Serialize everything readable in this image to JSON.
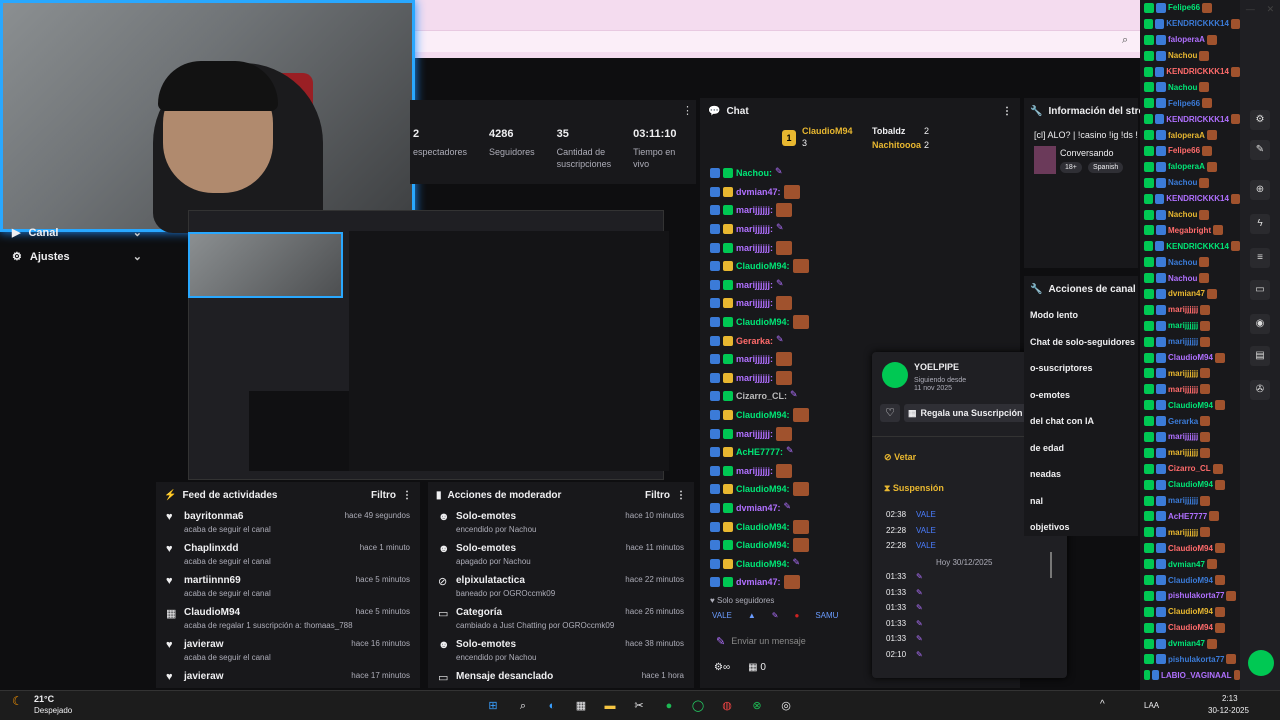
{
  "sidebar": {
    "items": [
      {
        "label": "Canal"
      },
      {
        "label": "Ajustes"
      }
    ]
  },
  "stats": [
    {
      "value": "2",
      "label": "espectadores"
    },
    {
      "value": "4286",
      "label": "Seguidores"
    },
    {
      "value": "35",
      "label": "Cantidad de suscripciones"
    },
    {
      "value": "03:11:10",
      "label": "Tiempo en vivo"
    }
  ],
  "feed": {
    "title": "Feed de actividades",
    "filter": "Filtro",
    "items": [
      {
        "name": "bayritonma6",
        "sub": "acaba de seguir el canal",
        "time": "hace 49 segundos"
      },
      {
        "name": "Chaplinxdd",
        "sub": "acaba de seguir el canal",
        "time": "hace 1 minuto"
      },
      {
        "name": "martiinnn69",
        "sub": "acaba de seguir el canal",
        "time": "hace 5 minutos"
      },
      {
        "name": "ClaudioM94",
        "sub": "acaba de regalar 1 suscripción a: thomaas_788",
        "time": "hace 5 minutos"
      },
      {
        "name": "javieraw",
        "sub": "acaba de seguir el canal",
        "time": "hace 16 minutos"
      },
      {
        "name": "javieraw",
        "sub": "",
        "time": "hace 17 minutos"
      }
    ]
  },
  "mod": {
    "title": "Acciones de moderador",
    "filter": "Filtro",
    "items": [
      {
        "name": "Solo-emotes",
        "sub": "encendido por Nachou",
        "time": "hace 10 minutos"
      },
      {
        "name": "Solo-emotes",
        "sub": "apagado por Nachou",
        "time": "hace 11 minutos"
      },
      {
        "name": "elpixulatactica",
        "sub": "baneado por OGROccmk09",
        "time": "hace 22 minutos"
      },
      {
        "name": "Categoría",
        "sub": "cambiado a Just Chatting por OGROccmk09",
        "time": "hace 26 minutos"
      },
      {
        "name": "Solo-emotes",
        "sub": "encendido por Nachou",
        "time": "hace 38 minutos"
      },
      {
        "name": "Mensaje desanclado",
        "sub": "",
        "time": "hace 1 hora"
      }
    ]
  },
  "chat": {
    "title": "Chat",
    "top": [
      {
        "name": "ClaudioM94",
        "count": "3"
      },
      {
        "name": "Tobaldz",
        "count": "2"
      },
      {
        "name": "Nachitoooa",
        "count": "2"
      }
    ],
    "messages": [
      {
        "user": "Nachou:",
        "color": "#00e676"
      },
      {
        "user": "dvmian47:",
        "color": "#b070ff"
      },
      {
        "user": "marijjjjjj:",
        "color": "#b070ff"
      },
      {
        "user": "marijjjjjj:",
        "color": "#b070ff"
      },
      {
        "user": "marijjjjjj:",
        "color": "#b070ff"
      },
      {
        "user": "ClaudioM94:",
        "color": "#00e676"
      },
      {
        "user": "marijjjjjj:",
        "color": "#b070ff"
      },
      {
        "user": "marijjjjjj:",
        "color": "#b070ff"
      },
      {
        "user": "ClaudioM94:",
        "color": "#00e676"
      },
      {
        "user": "Gerarka:",
        "color": "#ff6b6b"
      },
      {
        "user": "marijjjjjj:",
        "color": "#b070ff"
      },
      {
        "user": "marijjjjjj:",
        "color": "#b070ff"
      },
      {
        "user": "Cizarro_CL:",
        "color": "#bbbbbb"
      },
      {
        "user": "ClaudioM94:",
        "color": "#00e676"
      },
      {
        "user": "marijjjjjj:",
        "color": "#b070ff"
      },
      {
        "user": "AcHE7777:",
        "color": "#00e676"
      },
      {
        "user": "marijjjjjj:",
        "color": "#b070ff"
      },
      {
        "user": "ClaudioM94:",
        "color": "#00e676"
      },
      {
        "user": "dvmian47:",
        "color": "#b070ff"
      },
      {
        "user": "ClaudioM94:",
        "color": "#00e676"
      },
      {
        "user": "ClaudioM94:",
        "color": "#00e676"
      },
      {
        "user": "ClaudioM94:",
        "color": "#00e676"
      },
      {
        "user": "dvmian47:",
        "color": "#b070ff"
      }
    ],
    "followers_only": "Solo seguidores",
    "input_placeholder": "Enviar un mensaje",
    "points": "0"
  },
  "card": {
    "user": "YOELPIPE",
    "since_label": "Siguiendo desde",
    "since_date": "11 nov 2025",
    "gift_button": "Regala una Suscripción",
    "ban": "Vetar",
    "timeout": "Suspensión",
    "log": [
      {
        "time": "02:38",
        "text": "VALE"
      },
      {
        "time": "22:28",
        "text": "VALE"
      },
      {
        "time": "22:28",
        "text": "VALE"
      }
    ],
    "day": "Hoy 30/12/2025",
    "log2": [
      "01:33",
      "01:33",
      "01:33",
      "01:33",
      "01:33",
      "02:10"
    ]
  },
  "stream_info": {
    "title": "Información del stream",
    "stream_title": "[cl] ALO? | !casino !ig !ds !voces !mocó",
    "category": "Conversando",
    "tags": [
      "18+",
      "Spanish"
    ]
  },
  "channel_actions": {
    "title": "Acciones de canal",
    "items": [
      "Modo lento",
      "Chat de solo-seguidores",
      "o-suscriptores",
      "o-emotes",
      "del chat con IA",
      "de edad",
      "neadas",
      "nal",
      "objetivos"
    ]
  },
  "right_chat": [
    "Felipe66",
    "KENDRICKKK14",
    "faloperaA",
    "Nachou",
    "KENDRICKKK14",
    "Nachou",
    "Felipe66",
    "KENDRICKKK14",
    "faloperaA",
    "Felipe66",
    "faloperaA",
    "Nachou",
    "KENDRICKKK14",
    "Nachou",
    "Megabright",
    "KENDRICKKK14",
    "Nachou",
    "Nachou",
    "dvmian47",
    "marijjjjjj",
    "marijjjjjj",
    "marijjjjjj",
    "ClaudioM94",
    "marijjjjjj",
    "marijjjjjj",
    "ClaudioM94",
    "Gerarka",
    "marijjjjjj",
    "marijjjjjj",
    "Cizarro_CL",
    "ClaudioM94",
    "marijjjjjj",
    "AcHE7777",
    "marijjjjjj",
    "ClaudioM94",
    "dvmian47",
    "ClaudioM94",
    "pishulakorta77",
    "ClaudioM94",
    "ClaudioM94",
    "dvmian47",
    "pishulakorta77",
    "LABIO_VAGINAAL"
  ],
  "taskbar": {
    "weather_temp": "21°C",
    "weather_desc": "Despejado",
    "lang": "LAA",
    "time": "2:13",
    "date": "30-12-2025"
  }
}
